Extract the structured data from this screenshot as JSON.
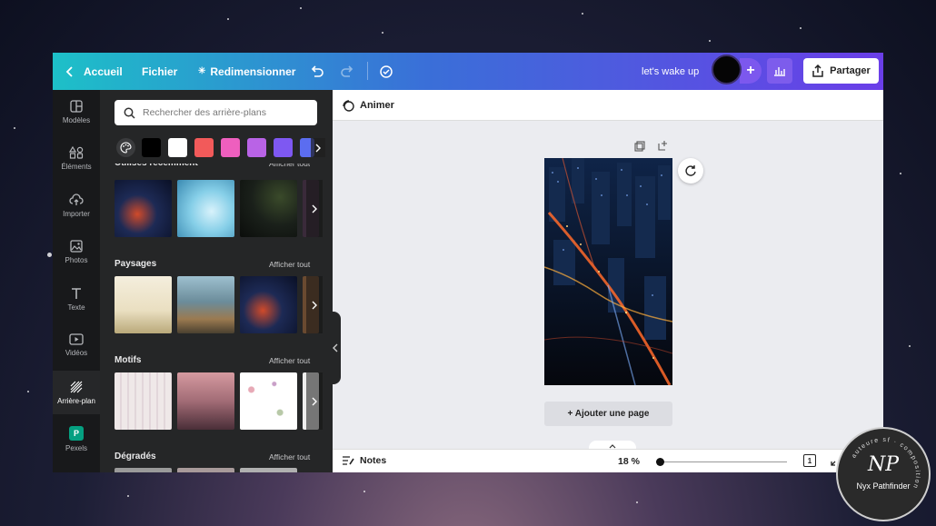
{
  "topbar": {
    "back_label": "Accueil",
    "file_label": "Fichier",
    "resize_label": "Redimensionner",
    "project_name": "let's wake up",
    "plus_symbol": "+",
    "share_label": "Partager"
  },
  "rail": {
    "items": [
      {
        "label": "Modèles",
        "icon": "templates-icon"
      },
      {
        "label": "Éléments",
        "icon": "elements-icon"
      },
      {
        "label": "Importer",
        "icon": "upload-cloud-icon"
      },
      {
        "label": "Photos",
        "icon": "photo-icon"
      },
      {
        "label": "Texte",
        "icon": "text-icon"
      },
      {
        "label": "Vidéos",
        "icon": "video-icon"
      },
      {
        "label": "Arrière-plan",
        "icon": "background-icon"
      },
      {
        "label": "Pexels",
        "icon": "pexels-icon"
      }
    ],
    "active": "Arrière-plan"
  },
  "panel": {
    "search_placeholder": "Rechercher des arrière-plans",
    "colors": [
      "#000000",
      "#ffffff",
      "#f25a5a",
      "#ee5fbe",
      "#b963e6",
      "#7e58f2",
      "#5b6df0"
    ],
    "see_all_label": "Afficher tout",
    "sections": [
      {
        "title": "Utilisés récemment",
        "see_all": "Afficher tout"
      },
      {
        "title": "Paysages",
        "see_all": "Afficher tout"
      },
      {
        "title": "Motifs",
        "see_all": "Afficher tout"
      },
      {
        "title": "Dégradés",
        "see_all": "Afficher tout"
      }
    ]
  },
  "editor": {
    "animate_label": "Animer",
    "add_page_label": "+ Ajouter une page",
    "notes_label": "Notes",
    "zoom": "18 %",
    "page_count": "1"
  },
  "watermark": {
    "name": "Nyx Pathfinder",
    "ring_text": "auteure sf · composition",
    "monogram": "NP"
  }
}
